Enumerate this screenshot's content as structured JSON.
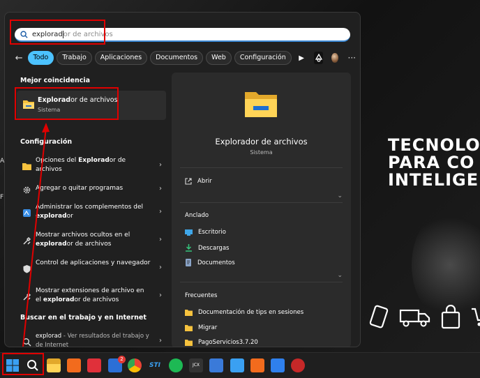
{
  "search": {
    "typed": "explorad",
    "suggestion": "or de archivos"
  },
  "filters": {
    "tabs": [
      "Todo",
      "Trabajo",
      "Aplicaciones",
      "Documentos",
      "Web",
      "Configuración"
    ]
  },
  "left": {
    "best_match_header": "Mejor coincidencia",
    "best_match": {
      "title_bold": "Explorad",
      "title_rest": "or de archivos",
      "subtitle": "Sistema"
    },
    "settings_header": "Configuración",
    "settings": [
      {
        "pre": "Opciones del ",
        "bold": "Explorad",
        "post": "or de archivos"
      },
      {
        "pre": "Agregar o quitar programas",
        "bold": "",
        "post": ""
      },
      {
        "pre": "Administrar los complementos del ",
        "bold": "explorad",
        "post": "or"
      },
      {
        "pre": "Mostrar archivos ocultos en el ",
        "bold": "explorad",
        "post": "or de archivos"
      },
      {
        "pre": "Control de aplicaciones y navegador",
        "bold": "",
        "post": ""
      },
      {
        "pre": "Mostrar extensiones de archivo en el ",
        "bold": "explorad",
        "post": "or de archivos"
      }
    ],
    "web_header": "Buscar en el trabajo y en Internet",
    "web_query": "explorad",
    "web_hint": " - Ver resultados del trabajo y de Internet"
  },
  "right": {
    "title": "Explorador de archivos",
    "subtitle": "Sistema",
    "open_label": "Abrir",
    "pinned_header": "Anclado",
    "pinned": [
      "Escritorio",
      "Descargas",
      "Documentos"
    ],
    "recent_header": "Frecuentes",
    "recent": [
      "Documentación de tips en sesiones",
      "Migrar",
      "PagoServicios3.7.20"
    ]
  },
  "background": {
    "promo_lines": [
      "TECNOLO",
      "PARA CO",
      "INTELIGE"
    ],
    "edge_text_1": "A",
    "edge_text_2": "F"
  },
  "taskbar": {
    "mail_badge": "2",
    "sti_label": "STI",
    "jcx_label": "JCX"
  },
  "colors": {
    "accent": "#4cc2ff",
    "highlight": "#e00000",
    "folder": "#f6c23e"
  }
}
